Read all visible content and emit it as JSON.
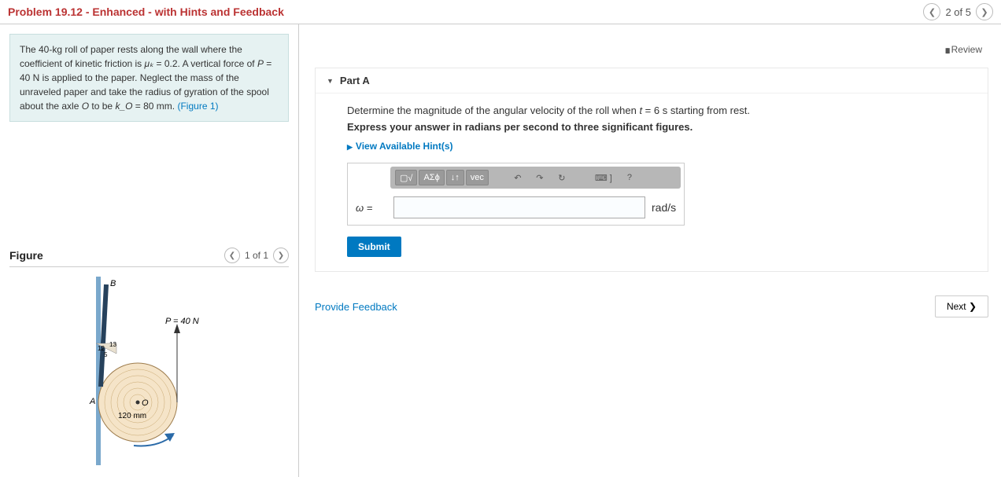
{
  "header": {
    "title": "Problem 19.12 - Enhanced - with Hints and Feedback",
    "page_status": "2 of 5"
  },
  "problem": {
    "text_prefix": "The 40-kg roll of paper rests along the wall where the coefficient of kinetic friction is ",
    "mu_k_sym": "μₖ",
    "mu_k_eq": " = 0.2. A vertical force of ",
    "P_sym": "P",
    "P_eq": " = 40 N is applied to the paper. Neglect the mass of the unraveled paper and take the radius of gyration of the spool about the axle ",
    "O_sym": "O",
    "kO_part": " to be ",
    "kO_sym": "k_O",
    "kO_eq": " = 80 mm. ",
    "fig_link": "(Figure 1)"
  },
  "figure": {
    "heading": "Figure",
    "page_status": "1 of 1",
    "labels": {
      "B": "B",
      "A": "A",
      "O": "O",
      "P": "P = 40 N",
      "ratio_a": "13",
      "ratio_b": "12",
      "ratio_c": "5",
      "radius": "120 mm"
    }
  },
  "review_label": "Review",
  "part": {
    "title": "Part A",
    "prompt_pre": "Determine the magnitude of the angular velocity of the roll when ",
    "t_sym": "t",
    "t_eq": " = 6 s starting from rest.",
    "instruct": "Express your answer in radians per second to three significant figures.",
    "hints_label": "View Available Hint(s)",
    "toolbar": {
      "tpl": "▢√",
      "greek": "ΑΣϕ",
      "subs": "↓↑",
      "vec": "vec",
      "undo": "↶",
      "redo": "↷",
      "reset": "↻",
      "keyboard": "⌨ ]",
      "help": "?"
    },
    "answer_label_sym": "ω =",
    "answer_value": "",
    "units": "rad/s",
    "submit": "Submit"
  },
  "footer": {
    "feedback": "Provide Feedback",
    "next": "Next ❯"
  }
}
